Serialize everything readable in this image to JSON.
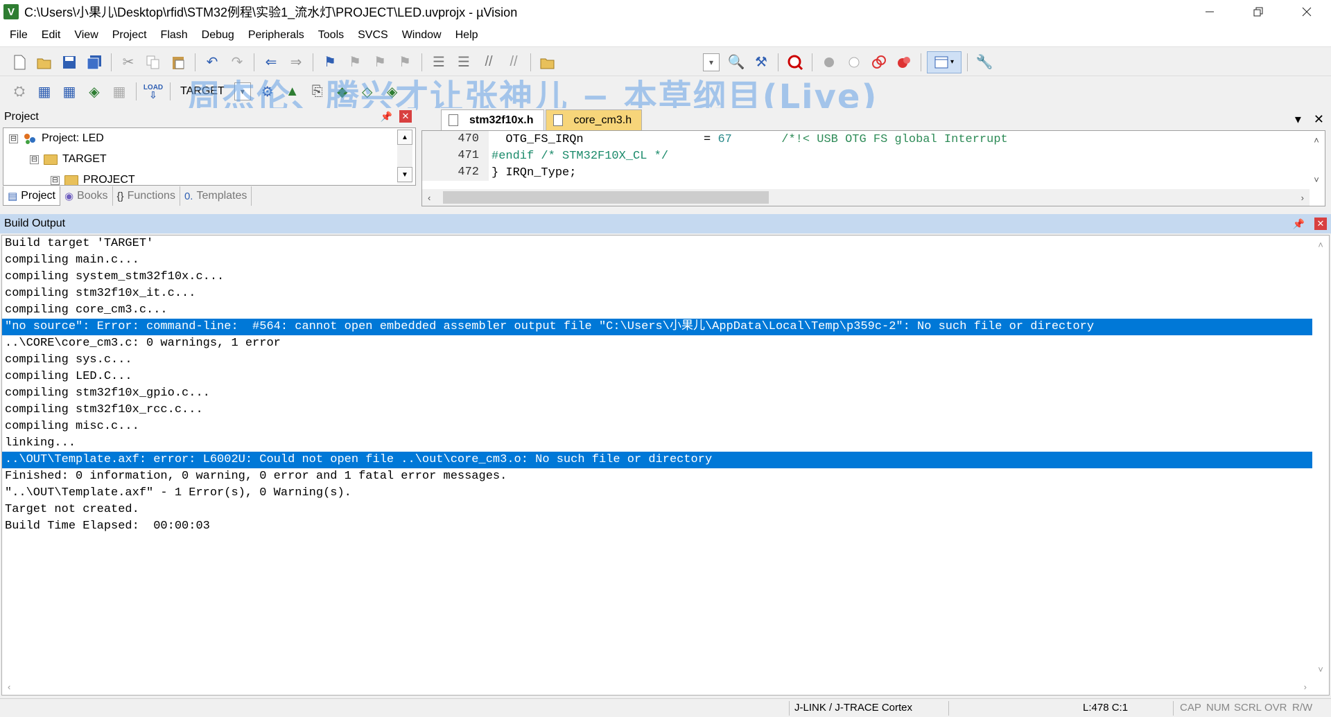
{
  "window": {
    "title": "C:\\Users\\小果儿\\Desktop\\rfid\\STM32例程\\实验1_流水灯\\PROJECT\\LED.uvprojx - µVision",
    "app_icon": "V"
  },
  "menu": [
    "File",
    "Edit",
    "View",
    "Project",
    "Flash",
    "Debug",
    "Peripherals",
    "Tools",
    "SVCS",
    "Window",
    "Help"
  ],
  "toolbar2": {
    "target": "TARGET"
  },
  "watermark": "周杰伦、腾兴才让张神儿 − 本草纲目(Live)",
  "project_panel": {
    "title": "Project",
    "tree": [
      {
        "label": "Project: LED",
        "depth": 0,
        "expander": "⊟"
      },
      {
        "label": "TARGET",
        "depth": 1,
        "expander": "⊟"
      },
      {
        "label": "PROJECT",
        "depth": 2,
        "expander": "⊟"
      }
    ],
    "tabs": [
      {
        "label": "Project",
        "active": true
      },
      {
        "label": "Books",
        "active": false
      },
      {
        "label": "Functions",
        "active": false
      },
      {
        "label": "Templates",
        "active": false
      }
    ]
  },
  "editor": {
    "tabs": [
      {
        "label": "stm32f10x.h",
        "active": true
      },
      {
        "label": "core_cm3.h",
        "active": false
      }
    ],
    "lines": [
      {
        "num": "470",
        "code": "  OTG_FS_IRQn                 = ",
        "value": "67",
        "comment": "       /*!< USB OTG FS global Interrupt"
      },
      {
        "num": "471",
        "code": "",
        "pp": "#endif /* STM32F10X_CL */",
        "value": "",
        "comment": ""
      },
      {
        "num": "472",
        "code": "} IRQn_Type;",
        "value": "",
        "comment": ""
      }
    ]
  },
  "build_output": {
    "title": "Build Output",
    "lines": [
      {
        "text": "Build target 'TARGET'",
        "selected": false
      },
      {
        "text": "compiling main.c...",
        "selected": false
      },
      {
        "text": "compiling system_stm32f10x.c...",
        "selected": false
      },
      {
        "text": "compiling stm32f10x_it.c...",
        "selected": false
      },
      {
        "text": "compiling core_cm3.c...",
        "selected": false
      },
      {
        "text": "\"no source\": Error: command-line:  #564: cannot open embedded assembler output file \"C:\\Users\\小果儿\\AppData\\Local\\Temp\\p359c-2\": No such file or directory",
        "selected": true
      },
      {
        "text": "..\\CORE\\core_cm3.c: 0 warnings, 1 error",
        "selected": false
      },
      {
        "text": "compiling sys.c...",
        "selected": false
      },
      {
        "text": "compiling LED.C...",
        "selected": false
      },
      {
        "text": "compiling stm32f10x_gpio.c...",
        "selected": false
      },
      {
        "text": "compiling stm32f10x_rcc.c...",
        "selected": false
      },
      {
        "text": "compiling misc.c...",
        "selected": false
      },
      {
        "text": "linking...",
        "selected": false
      },
      {
        "text": "..\\OUT\\Template.axf: error: L6002U: Could not open file ..\\out\\core_cm3.o: No such file or directory",
        "selected": true
      },
      {
        "text": "Finished: 0 information, 0 warning, 0 error and 1 fatal error messages.",
        "selected": false
      },
      {
        "text": "\"..\\OUT\\Template.axf\" - 1 Error(s), 0 Warning(s).",
        "selected": false
      },
      {
        "text": "Target not created.",
        "selected": false
      },
      {
        "text": "Build Time Elapsed:  00:00:03",
        "selected": false
      }
    ]
  },
  "statusbar": {
    "debugger": "J-LINK / J-TRACE Cortex",
    "position": "L:478 C:1",
    "flags": [
      "CAP",
      "NUM",
      "SCRL",
      "OVR",
      "R/W"
    ]
  }
}
